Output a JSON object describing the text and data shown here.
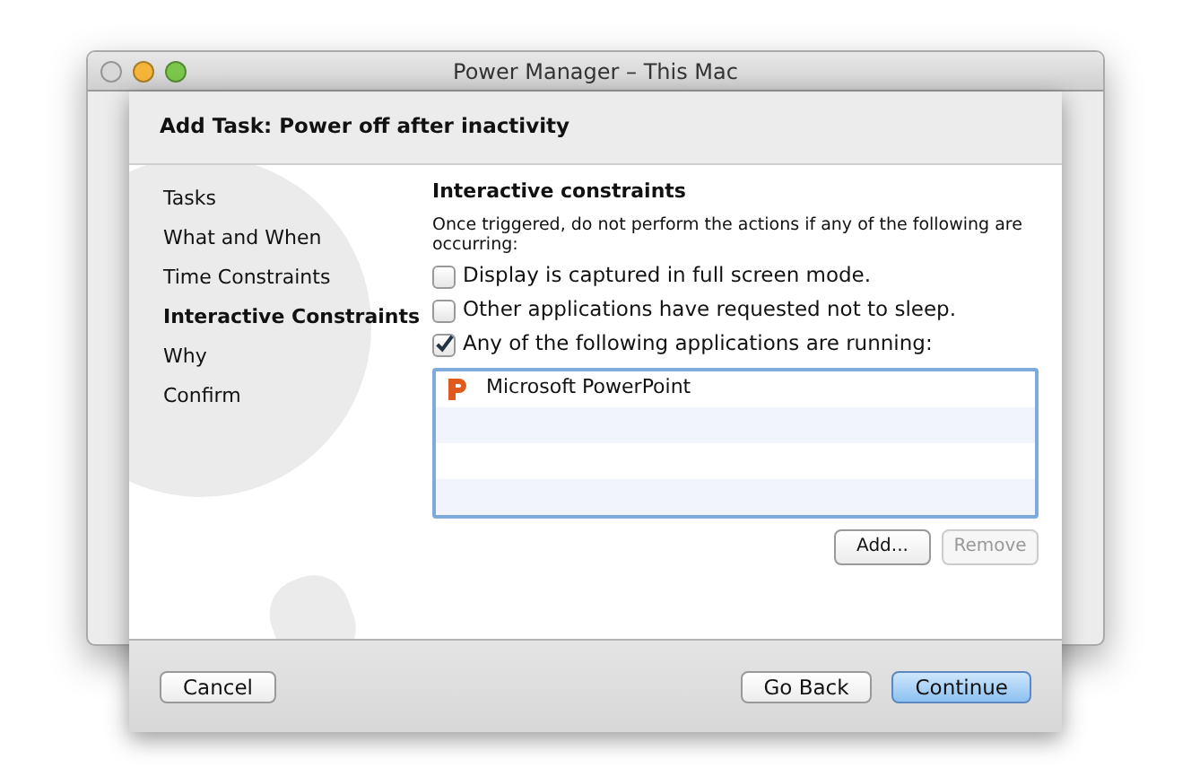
{
  "window": {
    "title": "Power Manager – This Mac"
  },
  "sheet": {
    "title": "Add Task: Power off after inactivity",
    "steps": [
      {
        "label": "Tasks",
        "selected": false
      },
      {
        "label": "What and When",
        "selected": false
      },
      {
        "label": "Time Constraints",
        "selected": false
      },
      {
        "label": "Interactive Constraints",
        "selected": true
      },
      {
        "label": "Why",
        "selected": false
      },
      {
        "label": "Confirm",
        "selected": false
      }
    ],
    "section_title": "Interactive constraints",
    "description": "Once triggered, do not perform the actions if any of the following are occurring:",
    "options": [
      {
        "label": "Display is captured in full screen mode.",
        "checked": false
      },
      {
        "label": "Other applications have requested not to sleep.",
        "checked": false
      },
      {
        "label": "Any of the following applications are running:",
        "checked": true
      }
    ],
    "applications": [
      {
        "name": "Microsoft PowerPoint"
      }
    ],
    "list_buttons": [
      {
        "label": "Add...",
        "disabled": false
      },
      {
        "label": "Remove",
        "disabled": true
      }
    ],
    "footer_buttons": [
      {
        "label": "Cancel",
        "default": false
      },
      {
        "label": "Go Back",
        "default": false
      },
      {
        "label": "Continue",
        "default": true
      }
    ]
  }
}
